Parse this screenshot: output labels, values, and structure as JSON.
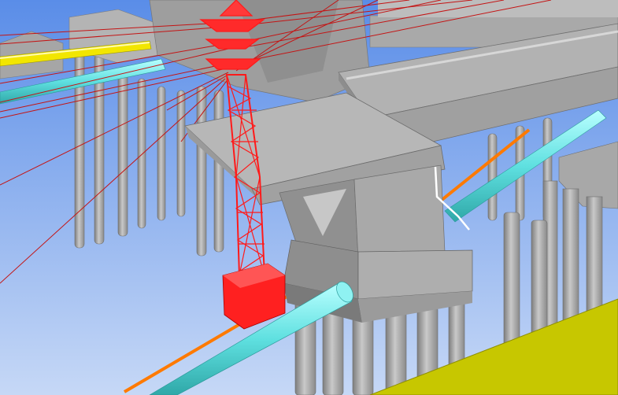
{
  "viewport": {
    "name": "3d-model-viewport",
    "sky_top_color": "#5a8de8",
    "sky_bottom_color": "#c6d8f6",
    "colors": {
      "pier_concrete": "#a9a9a9",
      "pier_shadow": "#8c8c8c",
      "pier_light": "#c4c4c4",
      "transmission_tower": "#ff1a1a",
      "tower_foundation": "#ff2020",
      "power_line": "#c41414",
      "water_pipe": "#66e6e6",
      "gas_pipe": "#ff7a00",
      "yellow_pipe": "#f2e600",
      "ground_slope": "#c7c700",
      "drain_pipe": "#ffffff"
    },
    "objects": [
      "bridge-pier-cap",
      "bridge-column",
      "pile-cap",
      "bridge-deck-girder",
      "transmission-tower",
      "tower-foundation",
      "power-lines",
      "water-pipe",
      "gas-pipe",
      "yellow-pipe",
      "ground-slope",
      "support-piles",
      "drain-pipe"
    ]
  }
}
